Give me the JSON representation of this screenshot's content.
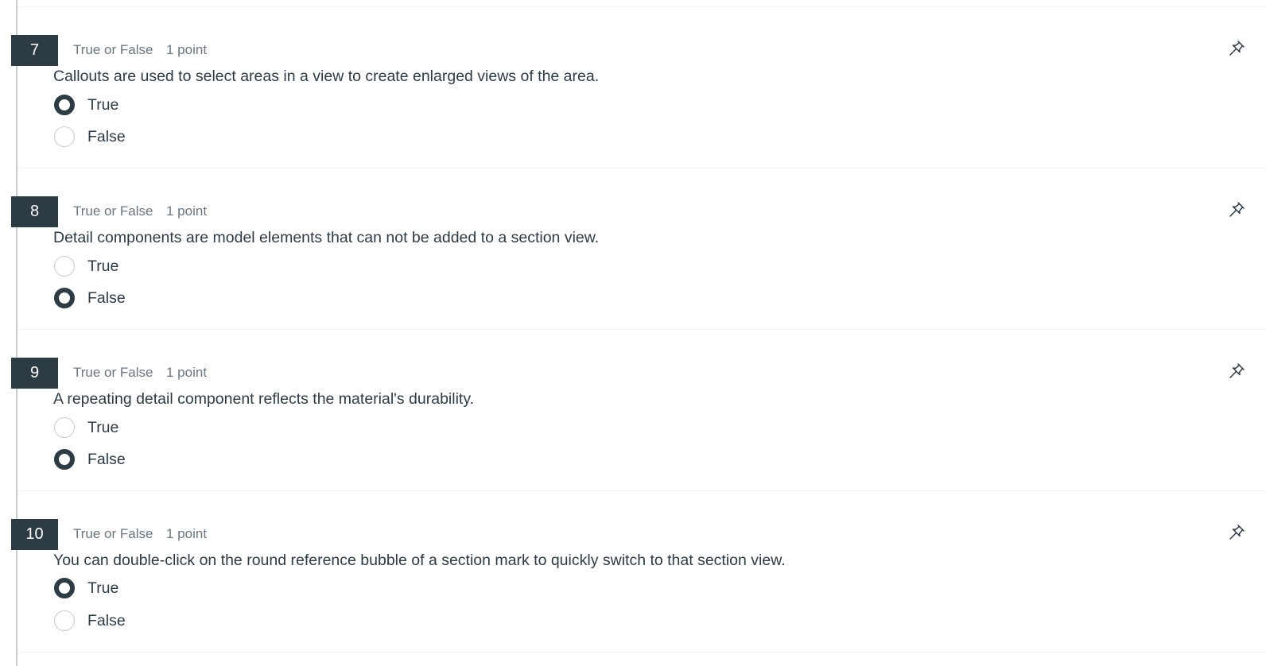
{
  "questions": [
    {
      "number": "7",
      "type": "True or False",
      "points": "1 point",
      "text": "Callouts are used to select areas in a view to create enlarged views of the area.",
      "options": [
        {
          "label": "True",
          "selected": true
        },
        {
          "label": "False",
          "selected": false
        }
      ]
    },
    {
      "number": "8",
      "type": "True or False",
      "points": "1 point",
      "text": "Detail components are model elements that can not be added to a section view.",
      "options": [
        {
          "label": "True",
          "selected": false
        },
        {
          "label": "False",
          "selected": true
        }
      ]
    },
    {
      "number": "9",
      "type": "True or False",
      "points": "1 point",
      "text": "A repeating detail component reflects the material's durability.",
      "options": [
        {
          "label": "True",
          "selected": false
        },
        {
          "label": "False",
          "selected": true
        }
      ]
    },
    {
      "number": "10",
      "type": "True or False",
      "points": "1 point",
      "text": "You can double-click on the round reference bubble of a section mark to quickly switch to that section view.",
      "options": [
        {
          "label": "True",
          "selected": true
        },
        {
          "label": "False",
          "selected": false
        }
      ]
    }
  ],
  "icons": {
    "pin": "pushpin-icon"
  },
  "colors": {
    "accent": "#2d3b45",
    "muted_text": "#6b7780",
    "radio_border": "#c7cdd1",
    "divider": "#eef0f2"
  }
}
